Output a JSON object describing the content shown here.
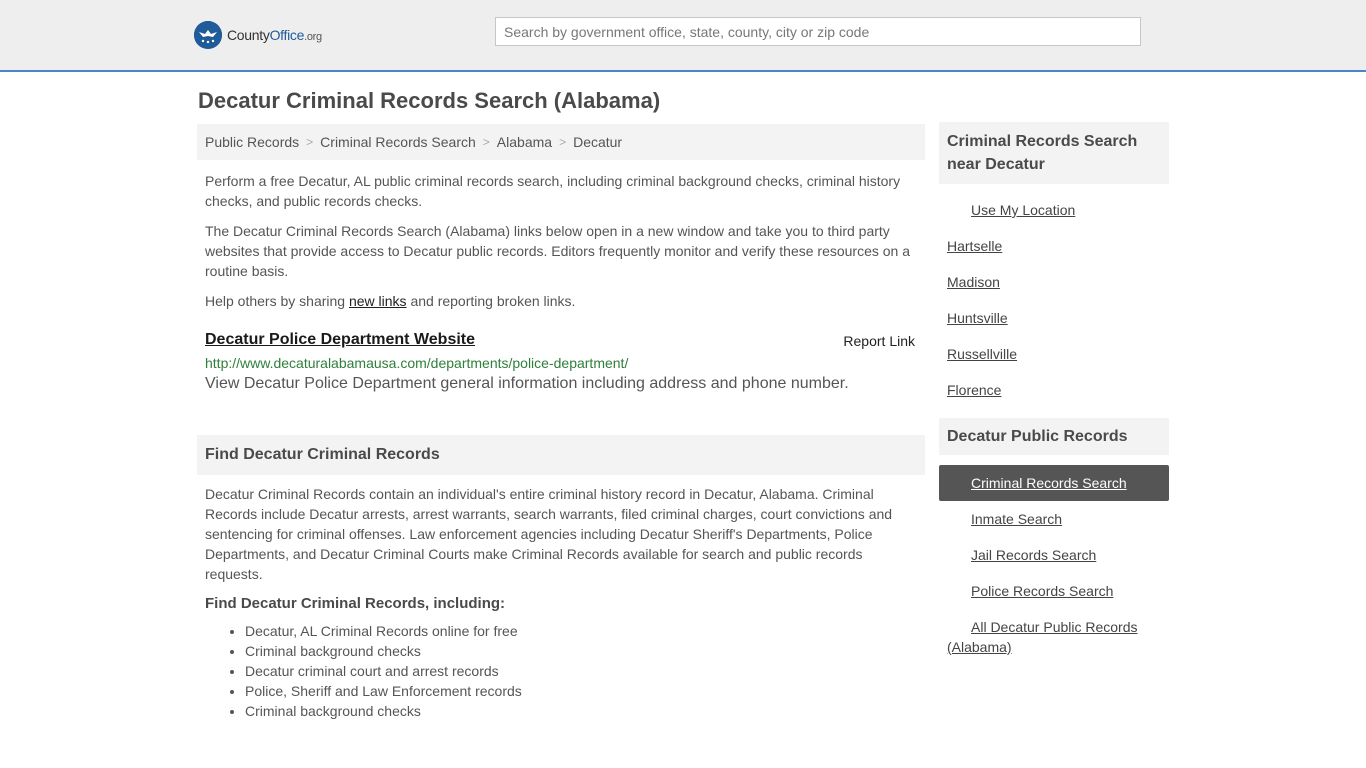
{
  "header": {
    "logo": {
      "brand": "County",
      "brand_accent": "Office",
      "tld": ".org"
    },
    "search_placeholder": "Search by government office, state, county, city or zip code"
  },
  "page_title": "Decatur Criminal Records Search (Alabama)",
  "breadcrumb": [
    "Public Records",
    "Criminal Records Search",
    "Alabama",
    "Decatur"
  ],
  "intro": {
    "p1": "Perform a free Decatur, AL public criminal records search, including criminal background checks, criminal history checks, and public records checks.",
    "p2": "The Decatur Criminal Records Search (Alabama) links below open in a new window and take you to third party websites that provide access to Decatur public records. Editors frequently monitor and verify these resources on a routine basis.",
    "p3_before": "Help others by sharing ",
    "p3_link": "new links",
    "p3_after": " and reporting broken links."
  },
  "result": {
    "title": "Decatur Police Department Website",
    "report_label": "Report Link",
    "url": "http://www.decaturalabamausa.com/departments/police-department/",
    "description": "View Decatur Police Department general information including address and phone number."
  },
  "find_section": {
    "heading": "Find Decatur Criminal Records",
    "body": "Decatur Criminal Records contain an individual's entire criminal history record in Decatur, Alabama. Criminal Records include Decatur arrests, arrest warrants, search warrants, filed criminal charges, court convictions and sentencing for criminal offenses. Law enforcement agencies including Decatur Sheriff's Departments, Police Departments, and Decatur Criminal Courts make Criminal Records available for search and public records requests.",
    "subheading": "Find Decatur Criminal Records, including:",
    "items": [
      "Decatur, AL Criminal Records online for free",
      "Criminal background checks",
      "Decatur criminal court and arrest records",
      "Police, Sheriff and Law Enforcement records",
      "Criminal background checks"
    ]
  },
  "sidebar": {
    "nearby_heading": "Criminal Records Search near Decatur",
    "use_location": "Use My Location",
    "nearby": [
      "Hartselle",
      "Madison",
      "Huntsville",
      "Russellville",
      "Florence"
    ],
    "records_heading": "Decatur Public Records",
    "records": [
      "Criminal Records Search",
      "Inmate Search",
      "Jail Records Search",
      "Police Records Search"
    ],
    "all_records": "All Decatur Public Records (Alabama)"
  }
}
